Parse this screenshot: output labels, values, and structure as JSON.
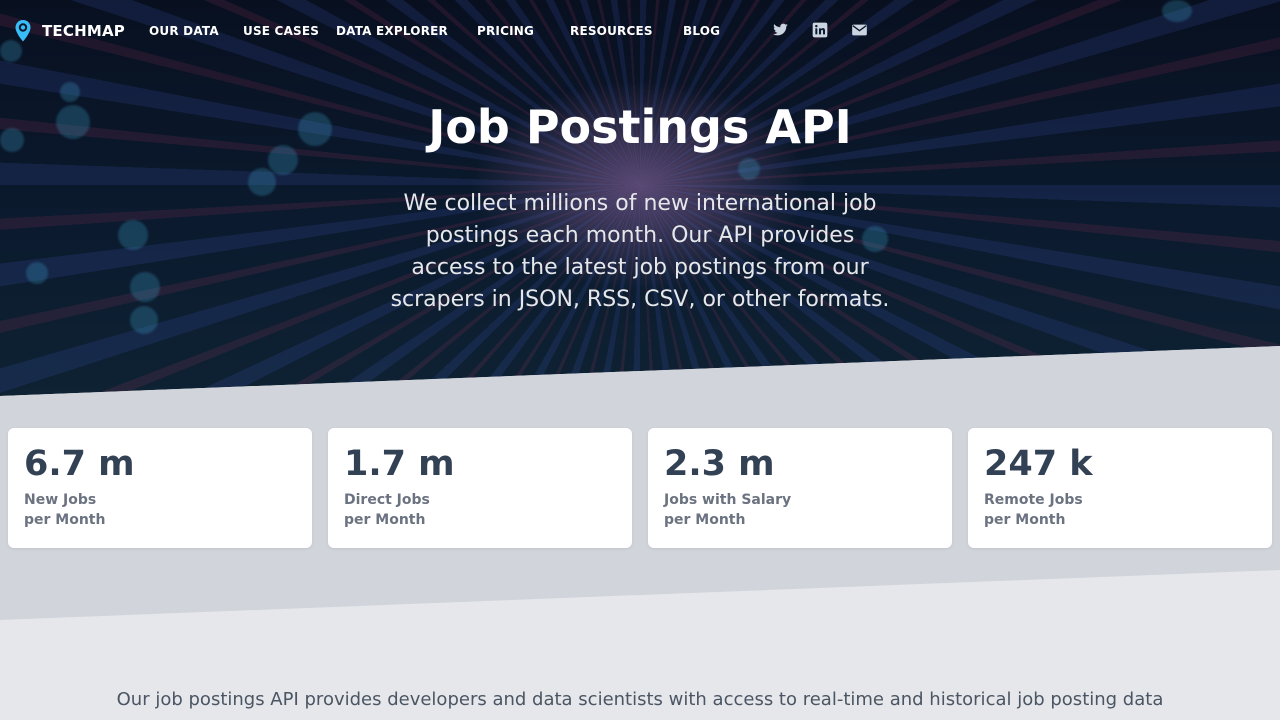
{
  "nav": {
    "brand": "TECHMAP",
    "links": [
      "OUR DATA",
      "USE CASES",
      "DATA EXPLORER",
      "PRICING",
      "RESOURCES",
      "BLOG"
    ],
    "social_icons": [
      "twitter-icon",
      "linkedin-icon",
      "email-icon"
    ]
  },
  "hero": {
    "title": "Job Postings API",
    "subtitle": "We collect millions of new international job postings each month. Our API provides access to the latest job postings from our scrapers in JSON, RSS, CSV, or other formats."
  },
  "stats": [
    {
      "value": "6.7 m",
      "label1": "New Jobs",
      "label2": "per Month"
    },
    {
      "value": "1.7 m",
      "label1": "Direct Jobs",
      "label2": "per Month"
    },
    {
      "value": "2.3 m",
      "label1": "Jobs with Salary",
      "label2": "per Month"
    },
    {
      "value": "247 k",
      "label1": "Remote Jobs",
      "label2": "per Month"
    }
  ],
  "intro": "Our job postings API provides developers and data scientists with access to real-time and historical job posting data",
  "colors": {
    "hero_bg": "#0b1a2e",
    "stats_band": "#d1d5db",
    "page_bg": "#e5e7eb",
    "stat_value": "#334155",
    "stat_label": "#6b7280",
    "logo_accent": "#38bdf8"
  }
}
